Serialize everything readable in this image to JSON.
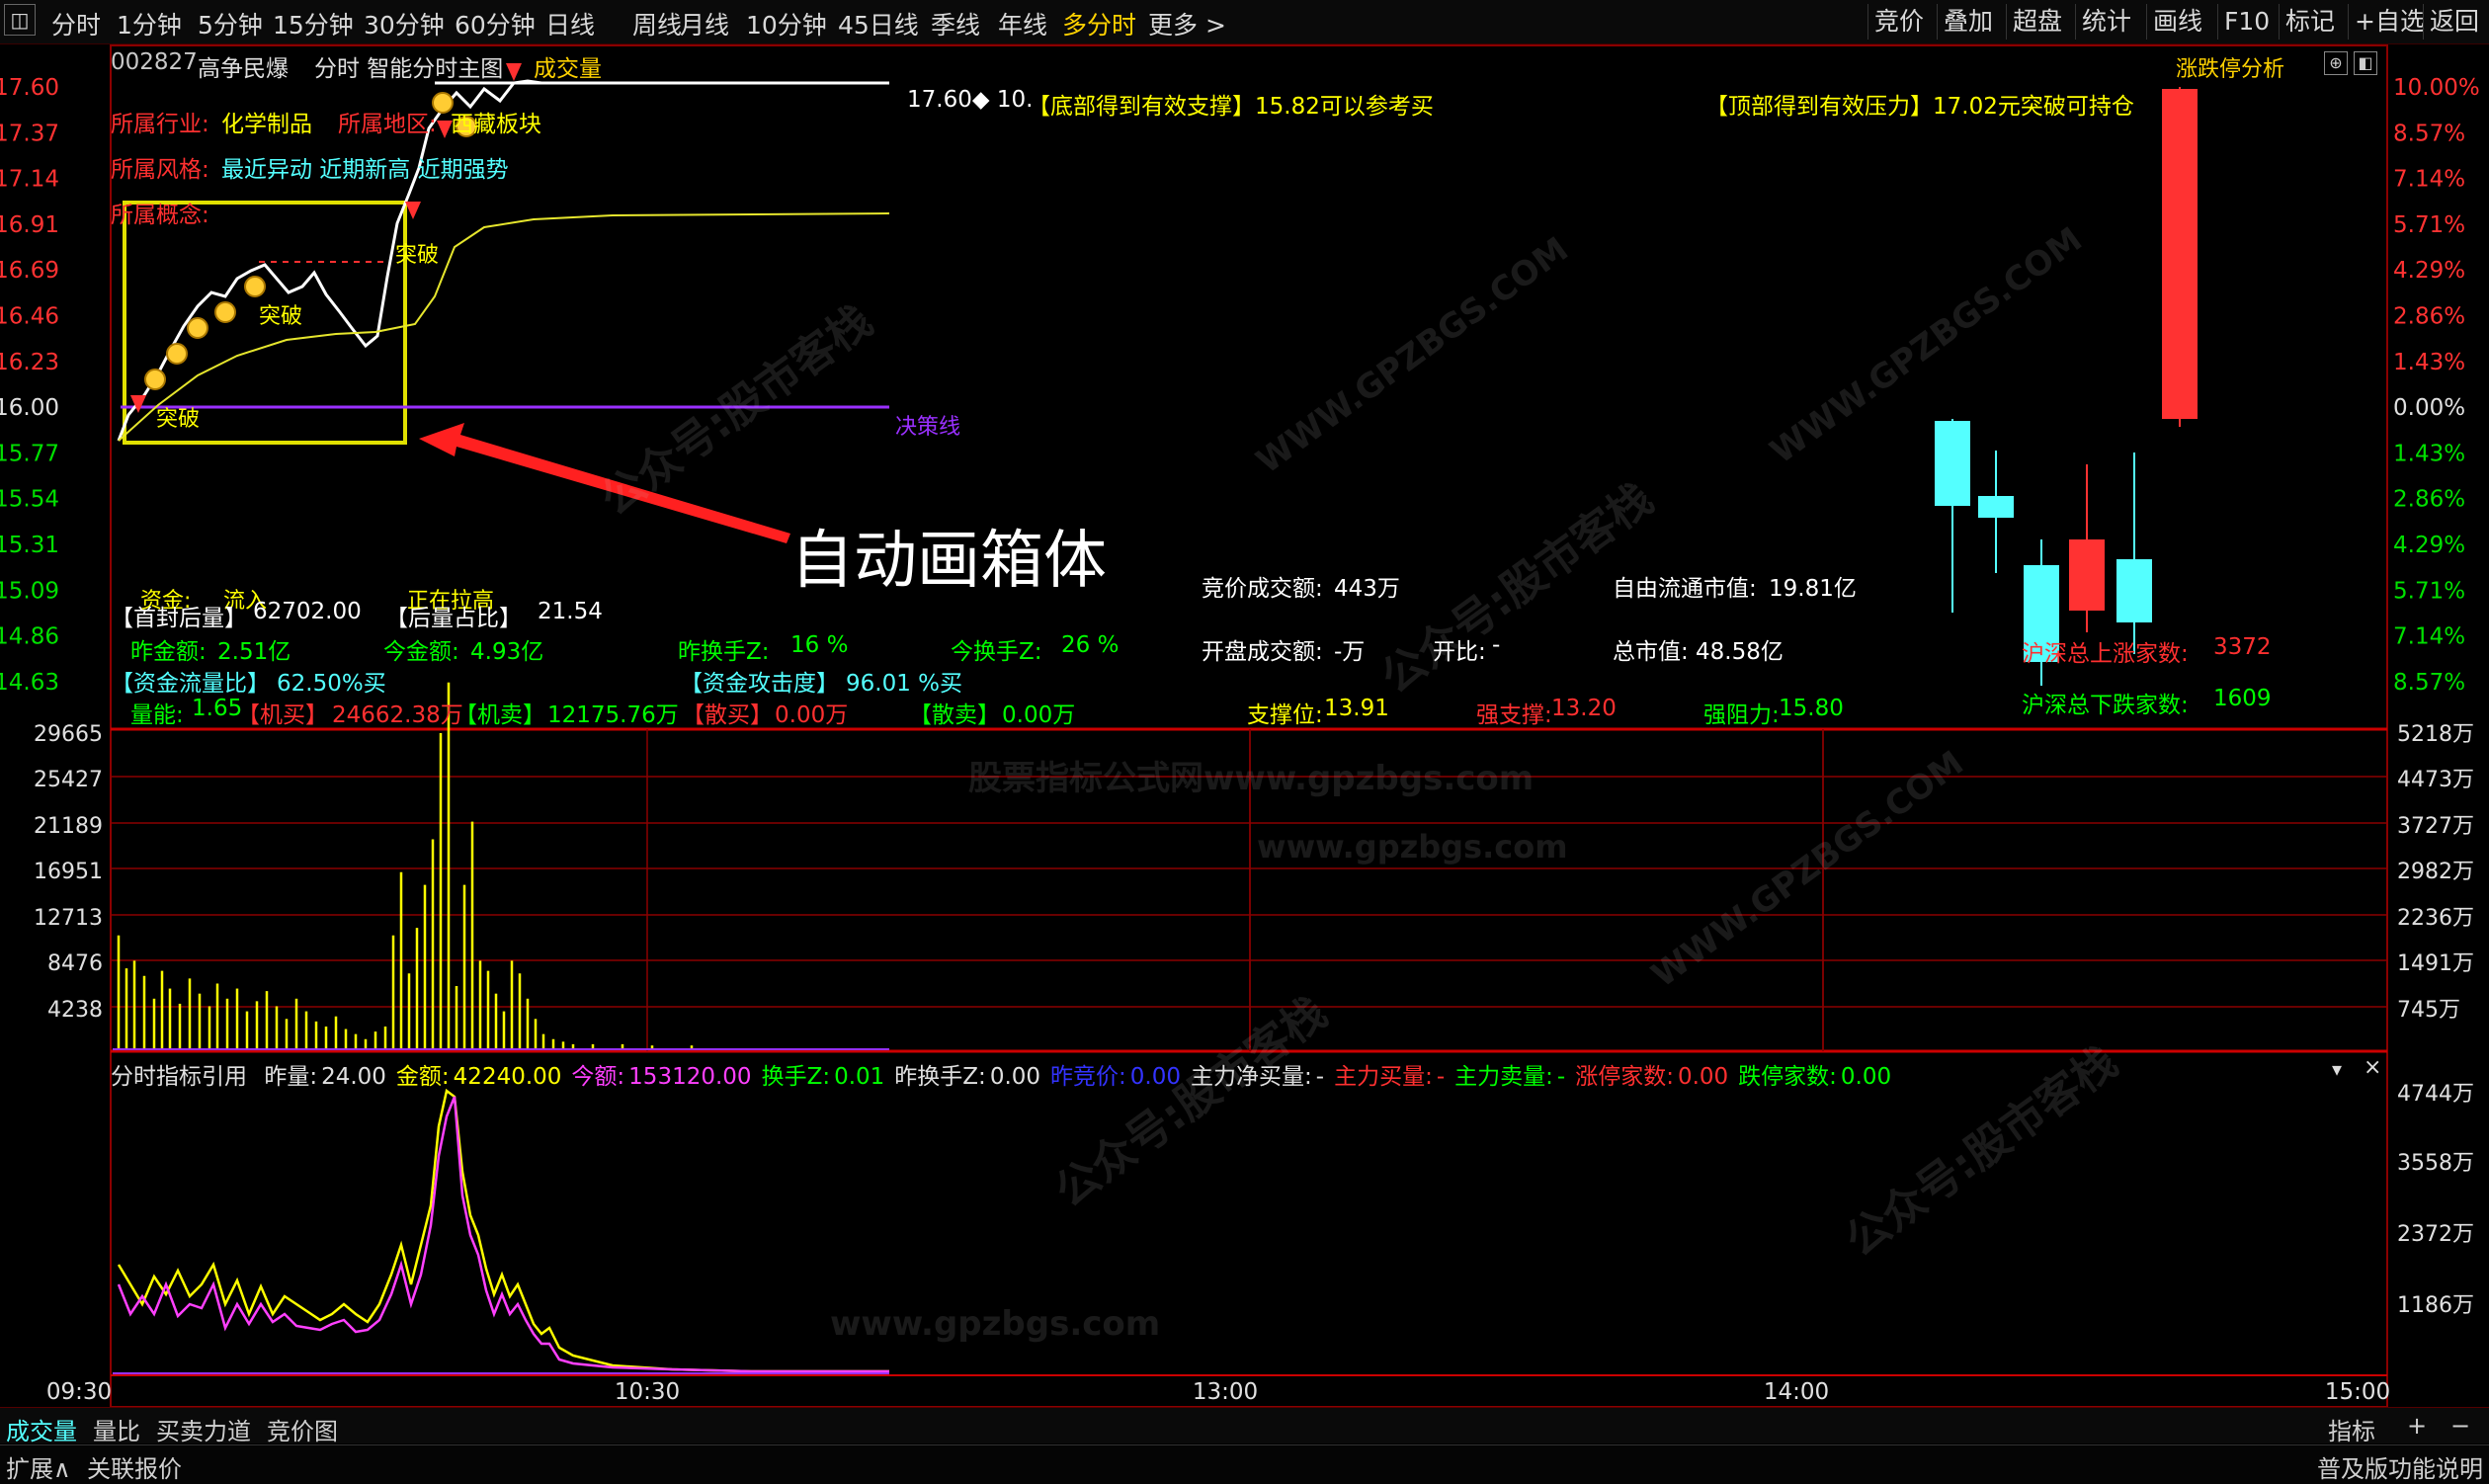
{
  "toolbar": {
    "tabs": [
      "分时",
      "1分钟",
      "5分钟",
      "15分钟",
      "30分钟",
      "60分钟",
      "日线",
      "周线",
      "月线",
      "10分钟",
      "45日线",
      "季线",
      "年线",
      "多分时",
      "更多 >"
    ],
    "active_tab": "多分时",
    "right_buttons": [
      "竞价",
      "叠加",
      "超盘",
      "统计",
      "画线",
      "F10",
      "标记",
      "+自选",
      "返回"
    ]
  },
  "stock": {
    "code": "002827",
    "name": "高争民爆",
    "chart_title": "分时 智能分时主图",
    "volume_label": "成交量",
    "limit_analysis": "涨跌停分析"
  },
  "price_axis": {
    "left": [
      "17.60",
      "17.37",
      "17.14",
      "16.91",
      "16.69",
      "16.46",
      "16.23",
      "16.00",
      "15.77",
      "15.54",
      "15.31",
      "15.09",
      "14.86",
      "14.63"
    ],
    "right": [
      "10.00%",
      "8.57%",
      "7.14%",
      "5.71%",
      "4.29%",
      "2.86%",
      "1.43%",
      "0.00%",
      "1.43%",
      "2.86%",
      "4.29%",
      "5.71%",
      "7.14%",
      "8.57%"
    ]
  },
  "vol_axis": {
    "left": [
      "29665",
      "25427",
      "21189",
      "16951",
      "12713",
      "8476",
      "4238"
    ],
    "right": [
      "5218万",
      "4473万",
      "3727万",
      "2982万",
      "2236万",
      "1491万",
      "745万"
    ]
  },
  "ind_axis": {
    "right": [
      "4744万",
      "3558万",
      "2372万",
      "1186万"
    ]
  },
  "time_axis": [
    "09:30",
    "10:30",
    "13:00",
    "14:00",
    "15:00"
  ],
  "info": {
    "industry_label": "所属行业:",
    "industry": "化学制品",
    "region_label": "所属地区:",
    "region": "西藏板块",
    "style_label": "所属风格:",
    "style": "最近异动 近期新高 近期强势",
    "concept_label": "所属概念:",
    "price_marker": "17.60◆ 10.",
    "support_note": "【底部得到有效支撑】15.82可以参考买",
    "pressure_note": "【顶部得到有效压力】17.02元突破可持仓",
    "breakthrough": "突破",
    "decision_line": "决策线",
    "annotation": "自动画箱体",
    "fund_in": "资金:",
    "flow_in": "流入",
    "pulling_up": "正在拉高",
    "first_seal_label": "【首封后量】",
    "first_seal_value": "62702.00",
    "after_ratio_label": "【后量占比】",
    "after_ratio_value": "21.54",
    "yest_amount_label": "昨金额:",
    "yest_amount": "2.51亿",
    "today_amount_label": "今金额:",
    "today_amount": "4.93亿",
    "yest_turn_label": "昨换手Z:",
    "yest_turn": "16 %",
    "today_turn_label": "今换手Z:",
    "today_turn": "26 %",
    "flow_ratio_label": "【资金流量比】",
    "flow_ratio": "62.50%买",
    "attack_label": "【资金攻击度】",
    "attack": "96.01 %买",
    "vol_energy_label": "量能:",
    "vol_energy": "1.65",
    "inst_buy_label": "【机买】",
    "inst_buy": "24662.38万",
    "inst_sell_label": "【机卖】",
    "inst_sell": "12175.76万",
    "retail_buy_label": "【散买】",
    "retail_buy": "0.00万",
    "retail_sell_label": "【散卖】",
    "retail_sell": "0.00万",
    "support_label": "支撑位:",
    "support": "13.91",
    "strong_support_label": "强支撑:",
    "strong_support": "13.20",
    "strong_resist_label": "强阻力:",
    "strong_resist": "15.80",
    "auction_amount_label": "竞价成交额:",
    "auction_amount": "443万",
    "open_amount_label": "开盘成交额:",
    "open_amount": "-万",
    "open_ratio_label": "开比:",
    "open_ratio": "-",
    "float_cap_label": "自由流通市值:",
    "float_cap": "19.81亿",
    "total_cap_label": "总市值:",
    "total_cap": "48.58亿",
    "up_count_label": "沪深总上涨家数:",
    "up_count": "3372",
    "down_count_label": "沪深总下跌家数:",
    "down_count": "1609"
  },
  "indicator": {
    "title": "分时指标引用",
    "items": [
      {
        "label": "昨量:",
        "value": "24.00",
        "color": "#e0e0e0"
      },
      {
        "label": "金额:",
        "value": "42240.00",
        "color": "#ffff00"
      },
      {
        "label": "今额:",
        "value": "153120.00",
        "color": "#ff40ff"
      },
      {
        "label": "换手Z:",
        "value": "0.01",
        "color": "#00ff00"
      },
      {
        "label": "昨换手Z:",
        "value": "0.00",
        "color": "#e0e0e0"
      },
      {
        "label": "昨竞价:",
        "value": "0.00",
        "color": "#3333ff"
      },
      {
        "label": "主力净买量:",
        "value": "-",
        "color": "#e0e0e0"
      },
      {
        "label": "主力买量:",
        "value": "-",
        "color": "#ff3030"
      },
      {
        "label": "主力卖量:",
        "value": "-",
        "color": "#00ff00"
      },
      {
        "label": "涨停家数:",
        "value": "0.00",
        "color": "#ff3030"
      },
      {
        "label": "跌停家数:",
        "value": "0.00",
        "color": "#00ff00"
      }
    ]
  },
  "bottom_tabs": [
    "成交量",
    "量比",
    "买卖力道",
    "竞价图"
  ],
  "bottom_right": [
    "指标",
    "+",
    "−"
  ],
  "bottom_bar2": [
    "扩展∧",
    "关联报价"
  ],
  "bottom_bar2_right": "普及版功能说明",
  "watermarks": [
    "公众号:股市客栈",
    "WWW.GPZBGS.COM",
    "股票公式网",
    "www.gpzbgs.com",
    "股票指标公式网www.gpzbgs.com"
  ],
  "colors": {
    "up": "#ff3232",
    "down": "#54ffff",
    "grid": "#8b0000",
    "box": "#e0e000",
    "avg": "#e6e62d",
    "decision": "#9a30ff"
  }
}
